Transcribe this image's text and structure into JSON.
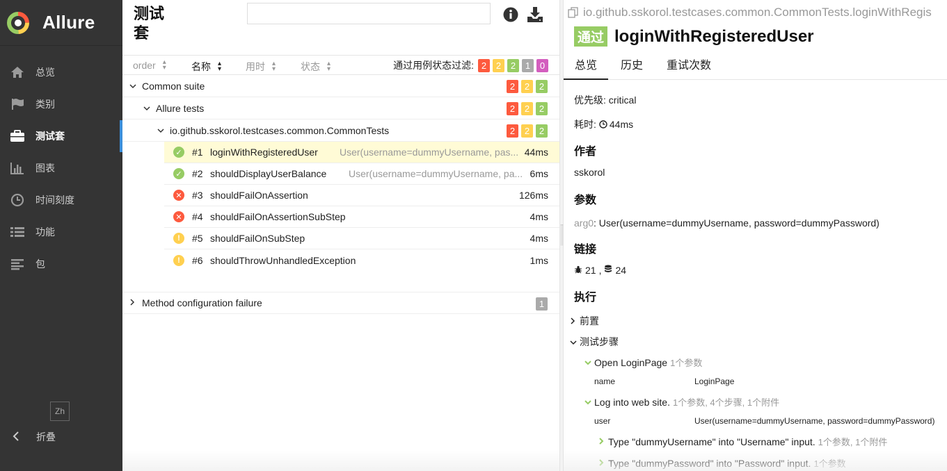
{
  "sidebar": {
    "brand": "Allure",
    "items": [
      {
        "label": "总览",
        "icon": "home-icon"
      },
      {
        "label": "类别",
        "icon": "flag-icon"
      },
      {
        "label": "测试套",
        "icon": "briefcase-icon",
        "active": true
      },
      {
        "label": "图表",
        "icon": "bar-chart-icon"
      },
      {
        "label": "时间刻度",
        "icon": "clock-icon"
      },
      {
        "label": "功能",
        "icon": "list-icon"
      },
      {
        "label": "包",
        "icon": "align-left-icon"
      }
    ],
    "lang": "Zh",
    "collapse_label": "折叠"
  },
  "suites": {
    "title": "测试套",
    "search_placeholder": "",
    "sort": {
      "order": "order",
      "name": "名称",
      "duration": "用时",
      "status": "状态"
    },
    "filter_label": "通过用例状态过滤:",
    "filter_counts": {
      "failed": "2",
      "broken": "2",
      "passed": "2",
      "skipped": "1",
      "unknown": "0"
    },
    "tree": [
      {
        "name": "Common suite",
        "failed": "2",
        "broken": "2",
        "passed": "2"
      },
      {
        "name": "Allure tests",
        "failed": "2",
        "broken": "2",
        "passed": "2"
      },
      {
        "name": "io.github.sskorol.testcases.common.CommonTests",
        "failed": "2",
        "broken": "2",
        "passed": "2"
      }
    ],
    "cases": [
      {
        "num": "#1",
        "name": "loginWithRegisteredUser",
        "param": "User(username=dummyUsername, pas...",
        "duration": "44ms",
        "status": "passed"
      },
      {
        "num": "#2",
        "name": "shouldDisplayUserBalance",
        "param": "User(username=dummyUsername, pa...",
        "duration": "6ms",
        "status": "passed"
      },
      {
        "num": "#3",
        "name": "shouldFailOnAssertion",
        "param": "",
        "duration": "126ms",
        "status": "failed"
      },
      {
        "num": "#4",
        "name": "shouldFailOnAssertionSubStep",
        "param": "",
        "duration": "4ms",
        "status": "failed"
      },
      {
        "num": "#5",
        "name": "shouldFailOnSubStep",
        "param": "",
        "duration": "4ms",
        "status": "broken"
      },
      {
        "num": "#6",
        "name": "shouldThrowUnhandledException",
        "param": "",
        "duration": "1ms",
        "status": "broken"
      }
    ],
    "other_suite": {
      "name": "Method configuration failure",
      "skipped": "1"
    }
  },
  "detail": {
    "breadcrumb": "io.github.sskorol.testcases.common.CommonTests.loginWithRegis",
    "status_label": "通过",
    "title": "loginWithRegisteredUser",
    "tabs": [
      "总览",
      "历史",
      "重试次数"
    ],
    "severity_label": "优先级:",
    "severity_value": "critical",
    "duration_label": "耗时:",
    "duration_value": "44ms",
    "author_heading": "作者",
    "author": "sskorol",
    "params_heading": "参数",
    "param_name": "arg0",
    "param_value": ": User(username=dummyUsername, password=dummyPassword)",
    "links_heading": "链接",
    "link_issue": "21",
    "link_sep": ",",
    "link_tms": "24",
    "exec_heading": "执行",
    "setup_label": "前置",
    "body_label": "测试步骤",
    "steps": [
      {
        "name": "Open LoginPage",
        "meta": "1个参数"
      },
      {
        "name": "Log into web site.",
        "meta": "1个参数, 4个步骤, 1个附件"
      }
    ],
    "step_params": [
      {
        "name": "name",
        "value": "LoginPage"
      },
      {
        "name": "user",
        "value": "User(username=dummyUsername, password=dummyPassword)"
      }
    ],
    "substeps": [
      {
        "name": "Type \"dummyUsername\" into \"Username\" input.",
        "meta": "1个参数, 1个附件"
      },
      {
        "name": "Type \"dummyPassword\" into \"Password\" input.",
        "meta": "1个参数"
      }
    ]
  },
  "colors": {
    "sidebar_bg": "#343434",
    "accent": "#3b8fdb",
    "passed": "#97cc64",
    "failed": "#fd5a3e",
    "broken": "#ffd050",
    "skipped": "#aaaaaa",
    "unknown": "#d35ebe"
  }
}
